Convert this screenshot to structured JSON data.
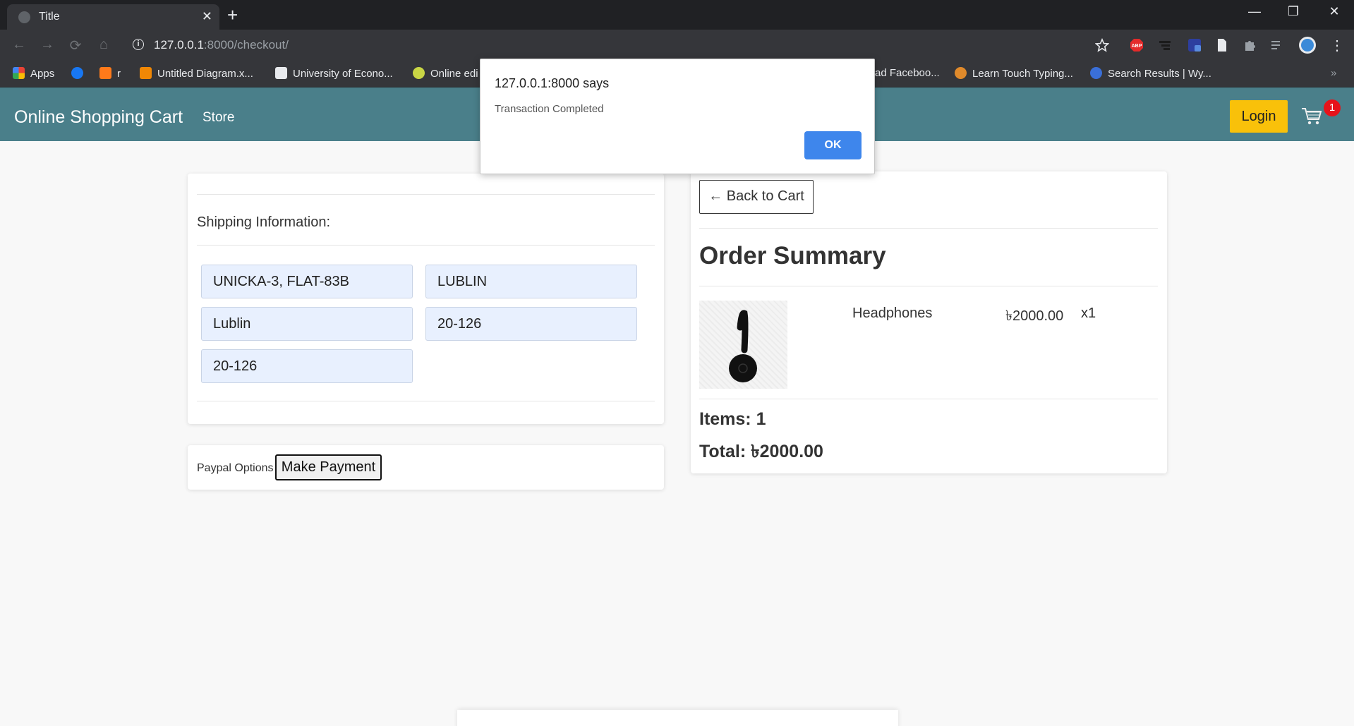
{
  "browser": {
    "tab_title": "Title",
    "tab_close": "✕",
    "new_tab": "+",
    "url_host": "127.0.0.1",
    "url_rest": ":8000/checkout/",
    "window_controls": {
      "minimize": "—",
      "maximize": "❐",
      "close": "✕"
    },
    "nav": {
      "back": "←",
      "forward": "→",
      "reload": "⟳",
      "home": "⌂"
    },
    "bookmarks": [
      {
        "label": "Apps",
        "icon": "apps-grid-icon"
      },
      {
        "label": "",
        "icon": "facebook-icon"
      },
      {
        "label": "r",
        "icon": "reddit-icon"
      },
      {
        "label": "Untitled Diagram.x...",
        "icon": "diagram-icon"
      },
      {
        "label": "University of Econo...",
        "icon": "university-icon"
      },
      {
        "label": "Online edi",
        "icon": "editor-icon"
      },
      {
        "label": "ad Faceboo...",
        "icon": "download-icon"
      },
      {
        "label": "Learn Touch Typing...",
        "icon": "typing-icon"
      },
      {
        "label": "Search Results | Wy...",
        "icon": "search-results-icon"
      }
    ],
    "bookmarks_overflow": "»"
  },
  "navbar": {
    "brand": "Online Shopping Cart",
    "store": "Store",
    "login": "Login",
    "cart_count": "1"
  },
  "shipping": {
    "title": "Shipping Information:",
    "fields": [
      "UNICKA-3, FLAT-83B",
      "LUBLIN",
      "Lublin",
      "20-126",
      "20-126"
    ]
  },
  "payment": {
    "label": "Paypal Options",
    "button": "Make Payment"
  },
  "summary": {
    "back": "← Back to Cart",
    "title": "Order Summary",
    "item": {
      "name": "Headphones",
      "price": "৳2000.00",
      "qty": "x1"
    },
    "items_count": "Items: 1",
    "total": "Total: ৳2000.00"
  },
  "dialog": {
    "title": "127.0.0.1:8000 says",
    "message": "Transaction Completed",
    "ok": "OK"
  },
  "colors": {
    "navbar": "#4a7f8a",
    "login": "#f9c10a",
    "badge": "#e7131a",
    "ok_button": "#3e86ec",
    "field": "#e8f0fe"
  }
}
